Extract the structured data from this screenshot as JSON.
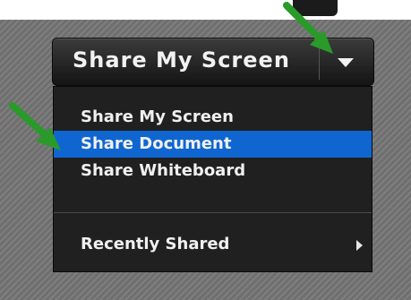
{
  "button": {
    "label": "Share My Screen",
    "dropdown_icon": "caret-down-icon"
  },
  "menu": {
    "items": [
      {
        "label": "Share My Screen"
      },
      {
        "label": "Share Document",
        "selected": true
      },
      {
        "label": "Share Whiteboard"
      }
    ],
    "recent": {
      "label": "Recently Shared",
      "icon": "chevron-right-icon"
    }
  },
  "annotations": {
    "arrow_icon": "green-arrow-icon",
    "arrow_color": "#2a9a2a"
  },
  "colors": {
    "selection": "#1066d0",
    "menu_bg": "#202020",
    "button_bg": "#1c1c1c"
  }
}
